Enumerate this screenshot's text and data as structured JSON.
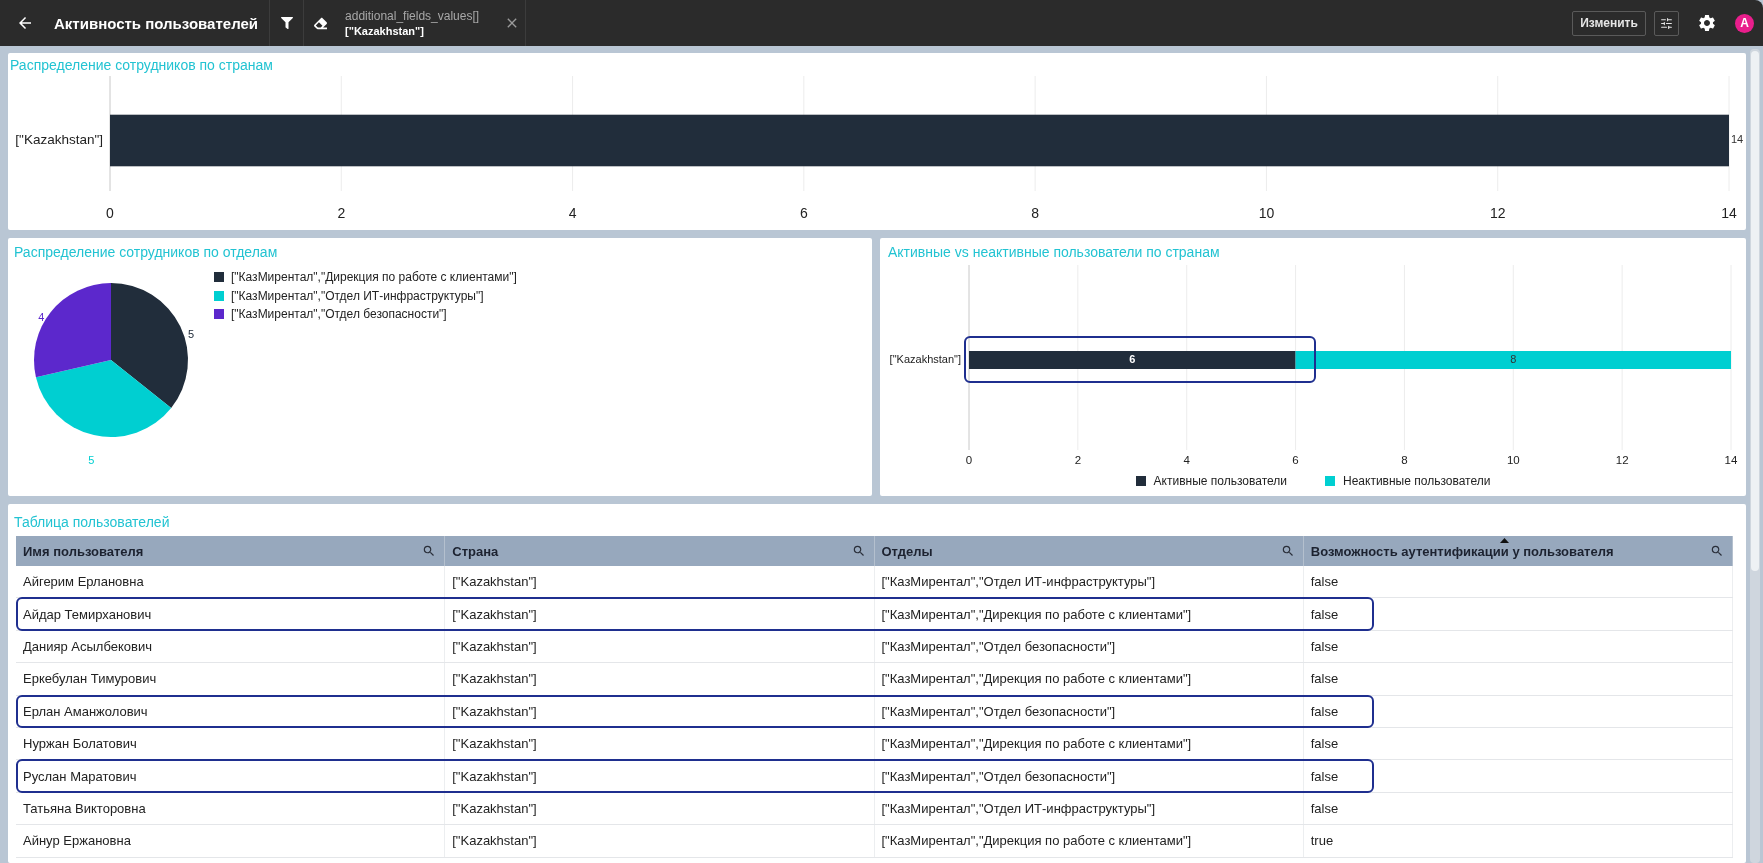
{
  "top_bar": {
    "title": "Активность пользователей",
    "filter_chip": {
      "field": "additional_fields_values[]",
      "value": "[\"Kazakhstan\"]"
    },
    "edit_button": "Изменить",
    "avatar": "A"
  },
  "country_chart": {
    "title": "Распределение сотрудников по странам",
    "chart_data": {
      "type": "bar",
      "orientation": "horizontal",
      "categories": [
        "[\"Kazakhstan\"]"
      ],
      "values": [
        14
      ],
      "xlim": [
        0,
        14
      ],
      "xticks": [
        0,
        2,
        4,
        6,
        8,
        10,
        12,
        14
      ],
      "grid": true,
      "data_labels": true
    }
  },
  "department_chart": {
    "title": "Распределение сотрудников по отделам",
    "chart_data": {
      "type": "pie",
      "categories": [
        "[\"КазМирентал\",\"Дирекция по работе с клиентами\"]",
        "[\"КазМирентал\",\"Отдел ИТ-инфраструктуры\"]",
        "[\"КазМирентал\",\"Отдел безопасности\"]"
      ],
      "values": [
        5,
        5,
        4
      ],
      "colors": [
        "#212d3b",
        "#00cfd1",
        "#5c28cc"
      ],
      "data_labels": true
    }
  },
  "activity_chart": {
    "title": "Активные vs неактивные пользователи по странам",
    "highlight_outline": true,
    "chart_data": {
      "type": "bar",
      "orientation": "horizontal",
      "stacked": true,
      "categories": [
        "[\"Kazakhstan\"]"
      ],
      "series": [
        {
          "name": "Активные пользователи",
          "color": "#212d3b",
          "values": [
            6
          ]
        },
        {
          "name": "Неактивные пользователи",
          "color": "#00cfd1",
          "values": [
            8
          ]
        }
      ],
      "xlim": [
        0,
        14
      ],
      "xticks": [
        0,
        2,
        4,
        6,
        8,
        10,
        12,
        14
      ],
      "grid": true,
      "data_labels": true
    }
  },
  "users_table": {
    "title": "Таблица пользователей",
    "columns": [
      {
        "label": "Имя пользователя",
        "sorted": false
      },
      {
        "label": "Страна",
        "sorted": false
      },
      {
        "label": "Отделы",
        "sorted": false
      },
      {
        "label": "Возможность аутентификации у пользователя",
        "sorted": true
      }
    ],
    "rows": [
      {
        "cells": [
          "Айгерим Ерлановна",
          "[\"Kazakhstan\"]",
          "[\"КазМирентал\",\"Отдел ИТ-инфраструктуры\"]",
          "false"
        ],
        "highlighted": false
      },
      {
        "cells": [
          "Айдар Темирханович",
          "[\"Kazakhstan\"]",
          "[\"КазМирентал\",\"Дирекция по работе с клиентами\"]",
          "false"
        ],
        "highlighted": true
      },
      {
        "cells": [
          "Данияр Асылбекович",
          "[\"Kazakhstan\"]",
          "[\"КазМирентал\",\"Отдел безопасности\"]",
          "false"
        ],
        "highlighted": false
      },
      {
        "cells": [
          "Еркебулан Тимурович",
          "[\"Kazakhstan\"]",
          "[\"КазМирентал\",\"Дирекция по работе с клиентами\"]",
          "false"
        ],
        "highlighted": false
      },
      {
        "cells": [
          "Ерлан Аманжолович",
          "[\"Kazakhstan\"]",
          "[\"КазМирентал\",\"Отдел безопасности\"]",
          "false"
        ],
        "highlighted": true
      },
      {
        "cells": [
          "Нуржан Болатович",
          "[\"Kazakhstan\"]",
          "[\"КазМирентал\",\"Дирекция по работе с клиентами\"]",
          "false"
        ],
        "highlighted": false
      },
      {
        "cells": [
          "Руслан Маратович",
          "[\"Kazakhstan\"]",
          "[\"КазМирентал\",\"Отдел безопасности\"]",
          "false"
        ],
        "highlighted": true
      },
      {
        "cells": [
          "Татьяна Викторовна",
          "[\"Kazakhstan\"]",
          "[\"КазМирентал\",\"Отдел ИТ-инфраструктуры\"]",
          "false"
        ],
        "highlighted": false
      },
      {
        "cells": [
          "Айнур Ержановна",
          "[\"Kazakhstan\"]",
          "[\"КазМирентал\",\"Дирекция по работе с клиентами\"]",
          "true"
        ],
        "highlighted": false
      }
    ]
  }
}
